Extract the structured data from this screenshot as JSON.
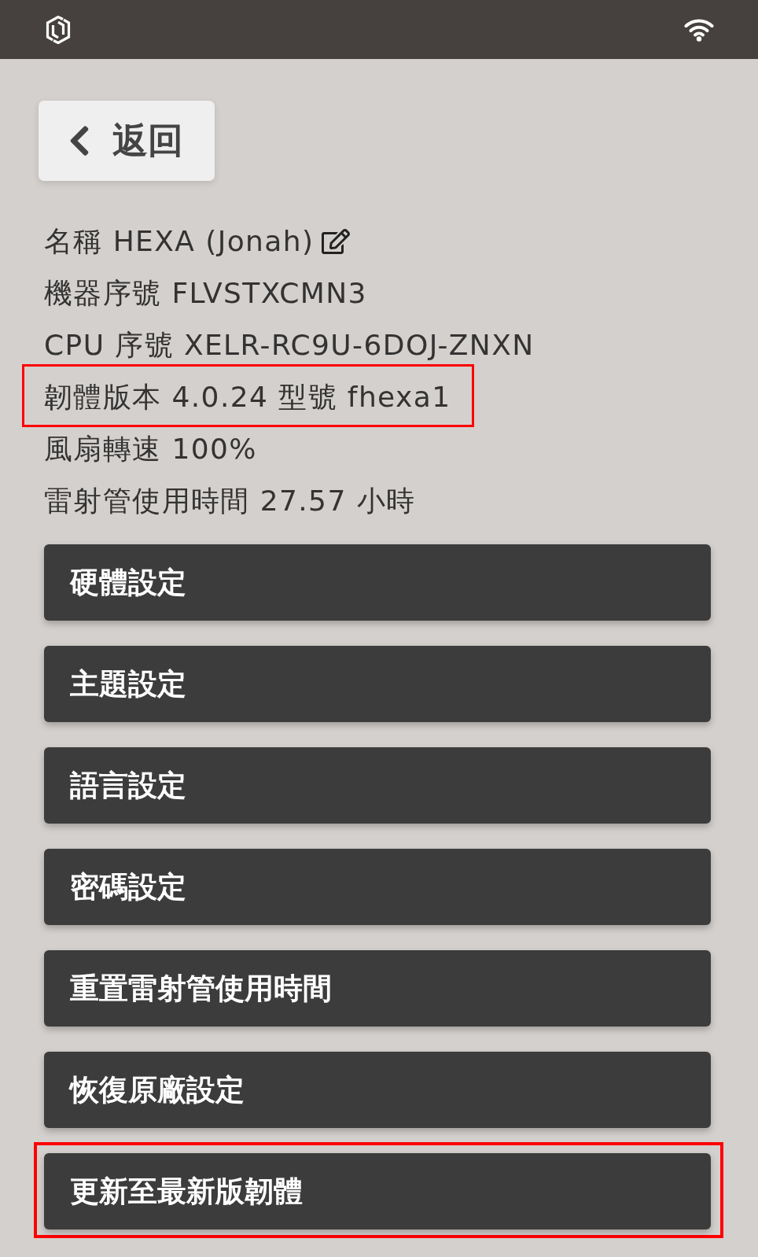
{
  "back_button": {
    "label": "返回"
  },
  "info_lines": [
    {
      "text": "名稱 HEXA (Jonah)",
      "editable": true,
      "highlighted": false
    },
    {
      "text": "機器序號 FLVSTXCMN3",
      "editable": false,
      "highlighted": false
    },
    {
      "text": "CPU 序號 XELR-RC9U-6DOJ-ZNXN",
      "editable": false,
      "highlighted": false
    },
    {
      "text": "韌體版本 4.0.24 型號 fhexa1",
      "editable": false,
      "highlighted": true
    },
    {
      "text": "風扇轉速 100%",
      "editable": false,
      "highlighted": false
    },
    {
      "text": "雷射管使用時間 27.57 小時",
      "editable": false,
      "highlighted": false
    }
  ],
  "menu_buttons": [
    {
      "label": "硬體設定",
      "highlighted": false
    },
    {
      "label": "主題設定",
      "highlighted": false
    },
    {
      "label": "語言設定",
      "highlighted": false
    },
    {
      "label": "密碼設定",
      "highlighted": false
    },
    {
      "label": "重置雷射管使用時間",
      "highlighted": false
    },
    {
      "label": "恢復原廠設定",
      "highlighted": false
    },
    {
      "label": "更新至最新版韌體",
      "highlighted": true
    }
  ]
}
